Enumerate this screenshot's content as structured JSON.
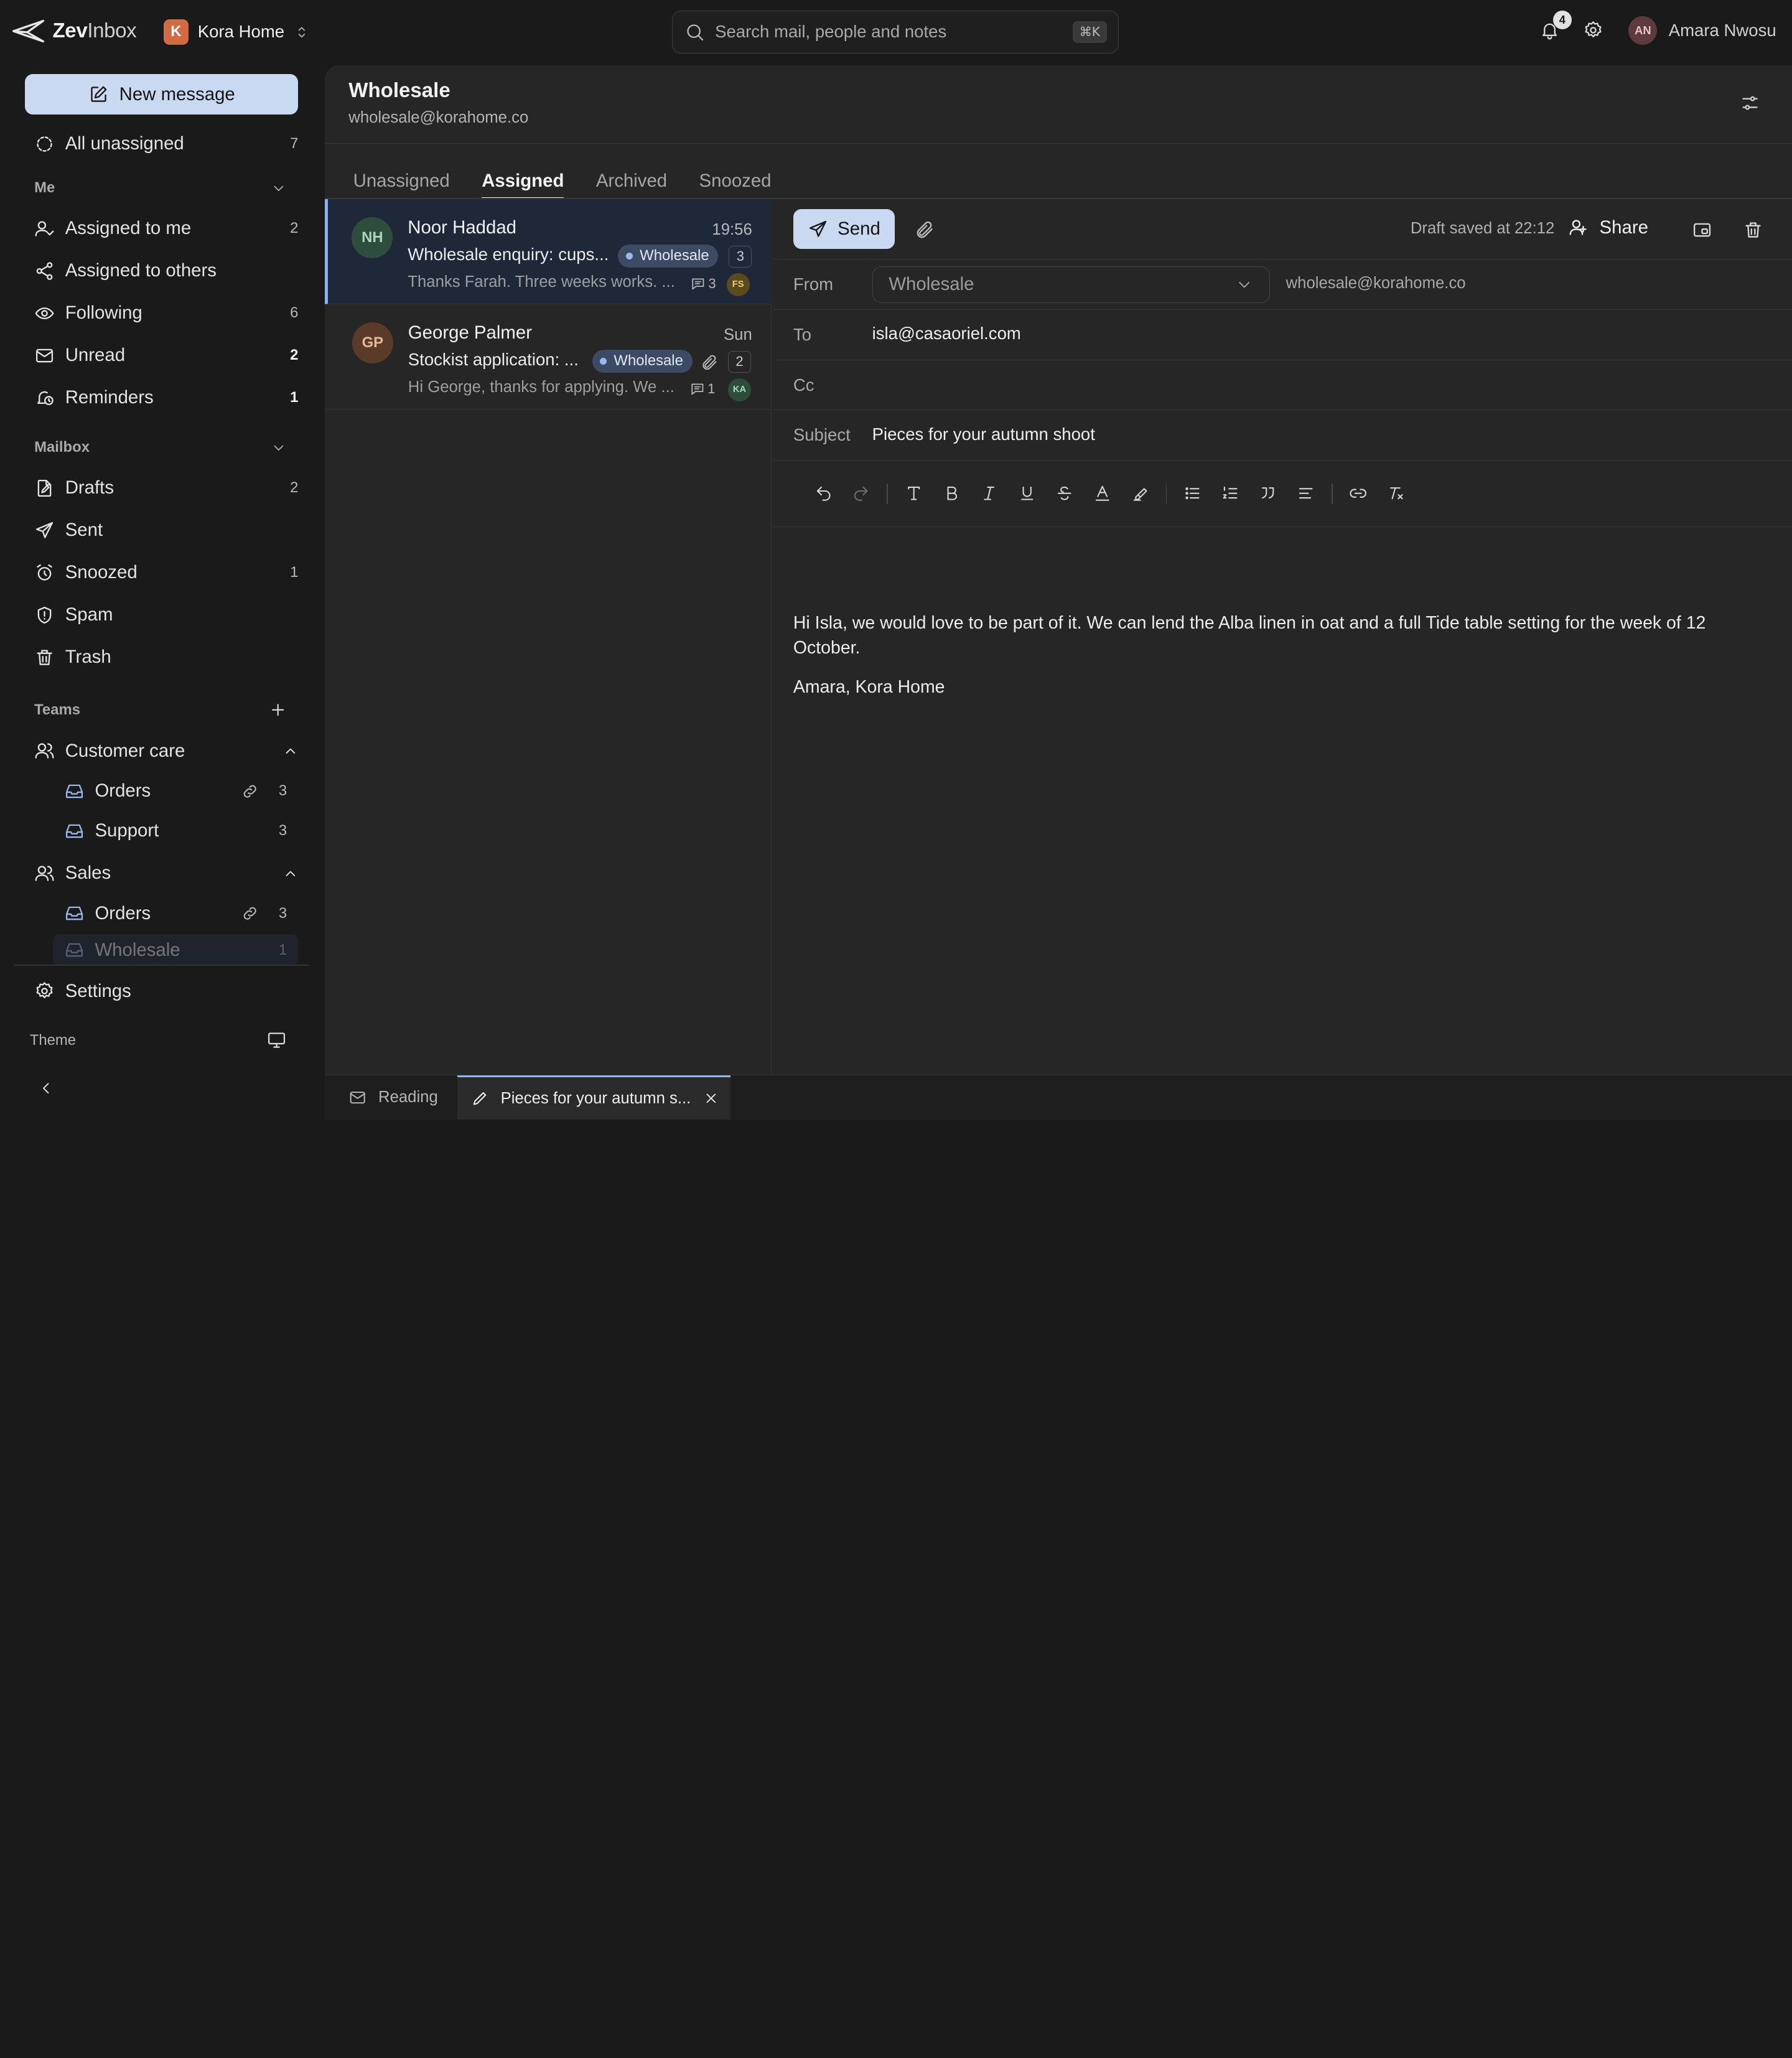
{
  "app": {
    "logo_bold": "Zev",
    "logo_rest": "Inbox",
    "workspace_initial": "K",
    "workspace_name": "Kora Home"
  },
  "search": {
    "placeholder": "Search mail, people and notes",
    "shortcut": "⌘K"
  },
  "topbar": {
    "notification_count": "4",
    "user_initials": "AN",
    "user_name": "Amara Nwosu"
  },
  "sidebar": {
    "new_message": "New message",
    "all_unassigned": {
      "label": "All unassigned",
      "count": "7"
    },
    "me_section": "Me",
    "me_items": [
      {
        "label": "Assigned to me",
        "count": "2"
      },
      {
        "label": "Assigned to others",
        "count": ""
      },
      {
        "label": "Following",
        "count": "6"
      },
      {
        "label": "Unread",
        "count": "2"
      },
      {
        "label": "Reminders",
        "count": "1"
      }
    ],
    "mailbox_section": "Mailbox",
    "mailbox_items": [
      {
        "label": "Drafts",
        "count": "2"
      },
      {
        "label": "Sent",
        "count": ""
      },
      {
        "label": "Snoozed",
        "count": "1"
      },
      {
        "label": "Spam",
        "count": ""
      },
      {
        "label": "Trash",
        "count": ""
      }
    ],
    "teams_section": "Teams",
    "teams": [
      {
        "label": "Customer care",
        "inboxes": [
          {
            "label": "Orders",
            "count": "3"
          },
          {
            "label": "Support",
            "count": "3"
          }
        ]
      },
      {
        "label": "Sales",
        "inboxes": [
          {
            "label": "Orders",
            "count": "3"
          },
          {
            "label": "Wholesale",
            "count": "1"
          }
        ]
      }
    ],
    "settings": "Settings",
    "theme": "Theme"
  },
  "inbox": {
    "title": "Wholesale",
    "address": "wholesale@korahome.co",
    "tabs": [
      "Unassigned",
      "Assigned",
      "Archived",
      "Snoozed"
    ],
    "active_tab": "Assigned"
  },
  "conversations": [
    {
      "initials": "NH",
      "name": "Noor Haddad",
      "time": "19:56",
      "subject": "Wholesale enquiry: cups...",
      "tag": "Wholesale",
      "message_count": "3",
      "preview": "Thanks Farah. Three weeks works. ...",
      "comments": "3",
      "assignee": "FS",
      "selected": true
    },
    {
      "initials": "GP",
      "name": "George Palmer",
      "time": "Sun",
      "subject": "Stockist application: ...",
      "tag": "Wholesale",
      "message_count": "2",
      "preview": "Hi George, thanks for applying. We ...",
      "comments": "1",
      "assignee": "KA",
      "has_attachment": true
    }
  ],
  "composer": {
    "send": "Send",
    "draft_status": "Draft saved at 22:12",
    "share": "Share",
    "from_label": "From",
    "from_value": "Wholesale",
    "from_address": "wholesale@korahome.co",
    "to_label": "To",
    "to_value": "isla@casaoriel.com",
    "cc_label": "Cc",
    "cc_value": "",
    "subject_label": "Subject",
    "subject_value": "Pieces for your autumn shoot",
    "body": [
      "Hi Isla, we would love to be part of it. We can lend the Alba linen in oat and a full Tide table setting for the week of 12 October.",
      "Amara, Kora Home"
    ]
  },
  "dock": {
    "reading": "Reading",
    "draft_tab": "Pieces for your autumn s..."
  },
  "colors": {
    "accent": "#c9d9f2",
    "selected_row": "#1e2838",
    "tag_bg": "#3d4a63",
    "workspace": "#d06a42"
  }
}
